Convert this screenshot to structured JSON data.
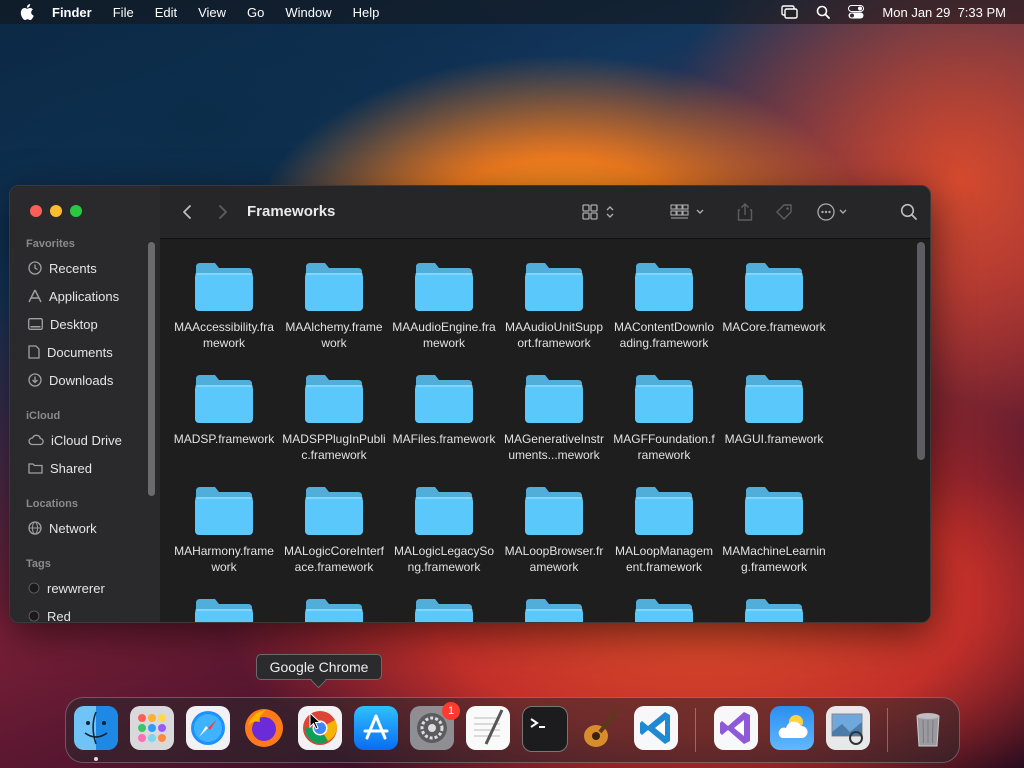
{
  "menubar": {
    "app_name": "Finder",
    "items": [
      "File",
      "Edit",
      "View",
      "Go",
      "Window",
      "Help"
    ],
    "clock": "Mon Jan 29  7:33 PM",
    "status_icons": [
      "screen-mirroring-icon",
      "spotlight-search-icon",
      "control-center-icon"
    ]
  },
  "finder": {
    "title": "Frameworks",
    "sidebar": {
      "favorites_header": "Favorites",
      "favorites": [
        "Recents",
        "Applications",
        "Desktop",
        "Documents",
        "Downloads"
      ],
      "icloud_header": "iCloud",
      "icloud": [
        "iCloud Drive",
        "Shared"
      ],
      "locations_header": "Locations",
      "locations": [
        "Network"
      ],
      "tags_header": "Tags",
      "tags": [
        "rewwrerer",
        "Red"
      ],
      "tag_colors": [
        "#1a1a1a",
        "#1a1a1a"
      ]
    },
    "folder_color": "#5ac8fa",
    "folders": [
      "MAAccessibility.framework",
      "MAAlchemy.framework",
      "MAAudioEngine.framework",
      "MAAudioUnitSupport.framework",
      "MAContentDownloading.framework",
      "MACore.framework",
      "MADSP.framework",
      "MADSPPlugInPublic.framework",
      "MAFiles.framework",
      "MAGenerativeInstruments...mework",
      "MAGFFoundation.framework",
      "MAGUI.framework",
      "MAHarmony.framework",
      "MALogicCoreInterface.framework",
      "MALogicLegacySong.framework",
      "MALoopBrowser.framework",
      "MALoopManagement.framework",
      "MAMachineLearning.framework"
    ]
  },
  "dock": {
    "tooltip": "Google Chrome",
    "apps": [
      "Finder",
      "Launchpad",
      "Safari",
      "Firefox",
      "Google Chrome",
      "App Store",
      "System Settings",
      "TextEdit",
      "Terminal",
      "GarageBand",
      "Visual Studio Code",
      "Visual Studio",
      "Weather",
      "Preview",
      "Trash"
    ],
    "system_settings_badge": "1"
  }
}
